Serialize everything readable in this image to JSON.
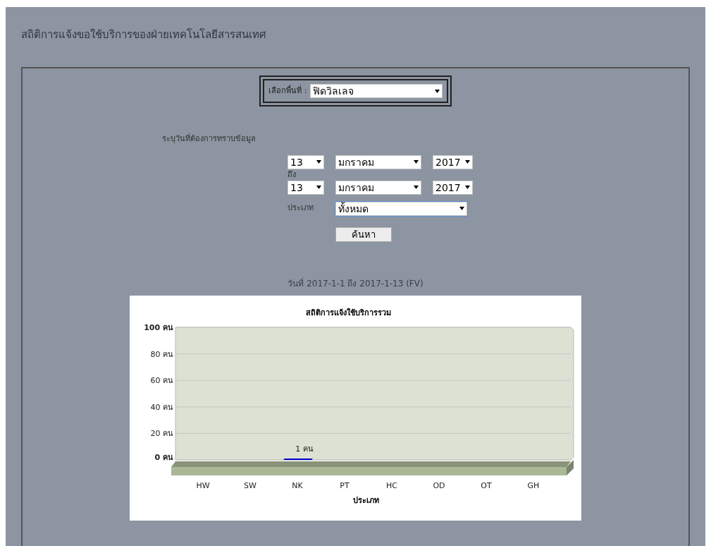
{
  "page_title": "สถิติการแจ้งขอใช้บริการของฝ่ายเทคโนโลยีสารสนเทศ",
  "area": {
    "label": "เลือกพื้นที่ :",
    "value": "ฟิดวิลเลจ"
  },
  "date_prompt": "ระบุวันที่ต้องการทราบข้อมูล",
  "from": {
    "day": "13",
    "month": "มกราคม",
    "year": "2017"
  },
  "to_label": "ถึง",
  "to": {
    "day": "13",
    "month": "มกราคม",
    "year": "2017"
  },
  "type": {
    "label": "ประเภท",
    "value": "ทั้งหมด"
  },
  "search_button": "ค้นหา",
  "result_caption": "วันที่ 2017-1-1 ถึง 2017-1-13 (FV)",
  "chart": {
    "chart_data": {
      "type": "bar",
      "title": "สถิติการแจ้งใช้บริการรวม",
      "xlabel": "ประเภท",
      "categories": [
        "HW",
        "SW",
        "NK",
        "PT",
        "HC",
        "OD",
        "OT",
        "GH"
      ],
      "series": [
        {
          "color": "#0000cc",
          "values": [
            0,
            0,
            1,
            0,
            0,
            0,
            0,
            0
          ]
        }
      ],
      "grid": true,
      "ylim": [
        0,
        100
      ],
      "yticks": [
        {
          "value": 0,
          "label": "0 คน"
        },
        {
          "value": 20,
          "label": "20 คน"
        },
        {
          "value": 40,
          "label": "40 คน"
        },
        {
          "value": 60,
          "label": "60 คน"
        },
        {
          "value": 80,
          "label": "80 คน"
        },
        {
          "value": 100,
          "label": "100 คน"
        }
      ],
      "value_labels": [
        null,
        null,
        "1 คน",
        null,
        null,
        null,
        null,
        null
      ]
    }
  }
}
